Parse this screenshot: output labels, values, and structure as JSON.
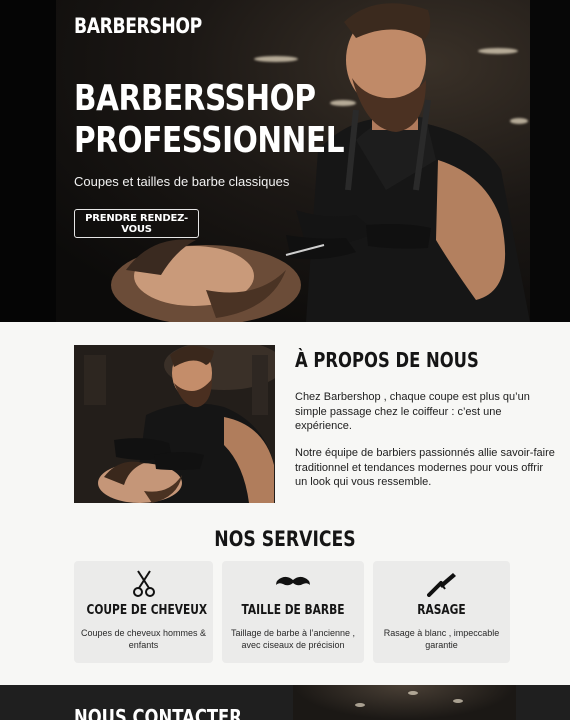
{
  "hero": {
    "brand": "BARBERSHOP",
    "title_line1": "BARBERSSHOP",
    "title_line2": "PROFESSIONNEL",
    "subtitle": "Coupes et tailles de barbe classiques",
    "cta_label": "PRENDRE RENDEZ-VOUS"
  },
  "about": {
    "title": "À PROPOS DE NOUS",
    "paragraph1": " Chez Barbershop , chaque coupe est plus qu’un simple passage chez le coiffeur : c’est une expérience.",
    "paragraph2": " Notre équipe de barbiers passionnés allie savoir-faire traditionnel et tendances modernes pour vous offrir un look qui vous ressemble."
  },
  "services": {
    "title": "NOS SERVICES",
    "items": [
      {
        "title": "COUPE DE CHEVEUX",
        "description": "Coupes de cheveux hommes & enfants",
        "icon": "scissors-icon"
      },
      {
        "title": "TAILLE DE BARBE",
        "description": "Taillage de barbe à l’ancienne , avec ciseaux de précision",
        "icon": "mustache-icon"
      },
      {
        "title": "RASAGE",
        "description": "Rasage à blanc , impeccable garantie",
        "icon": "razor-icon"
      }
    ]
  },
  "contact": {
    "title": "NOUS CONTACTER"
  },
  "colors": {
    "hero_bg": "#0c0b0a",
    "page_bg": "#f7f7f5",
    "card_bg": "#ebebea",
    "contact_bg": "#1f1f1f"
  }
}
